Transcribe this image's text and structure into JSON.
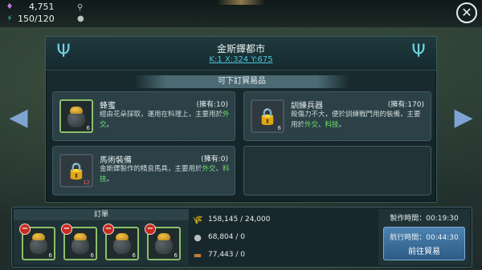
{
  "status_bar": {
    "gems": "4,751",
    "energy": "150/120"
  },
  "dialog": {
    "city_name": "金斯鐸都市",
    "coords": "K:1 X:324 Y:675",
    "section_title": "可下訂貿易品",
    "items": [
      {
        "title": "蜂蜜",
        "owned": "(擁有:10)",
        "desc_pre": "經由花朵採取，運用在料理上，主要用於",
        "desc_hl": [
          "外交"
        ],
        "desc_sep": "",
        "desc_post": "。",
        "count": "6",
        "locked": false
      },
      {
        "title": "訓練兵器",
        "owned": "(擁有:170)",
        "desc_pre": "殺傷力不大，便於訓練戰鬥用的裝備，主要用於",
        "desc_hl": [
          "外交",
          "科技"
        ],
        "desc_sep": "、",
        "desc_post": "。",
        "count": "6",
        "locked": true
      },
      {
        "title": "馬術裝備",
        "owned": "(擁有:0)",
        "desc_pre": "金斯鐸製作的精良馬具，主要用於",
        "desc_hl": [
          "外交",
          "科技"
        ],
        "desc_sep": "、",
        "desc_post": "。",
        "count": "12",
        "locked": true
      }
    ]
  },
  "orders": {
    "title": "訂單",
    "slots": [
      {
        "qty": "6"
      },
      {
        "qty": "6"
      },
      {
        "qty": "6"
      },
      {
        "qty": "6"
      }
    ]
  },
  "resources": [
    {
      "icon": "wheat-icon",
      "value": "158,145 / 24,000"
    },
    {
      "icon": "stone-icon",
      "value": "68,804 / 0"
    },
    {
      "icon": "wood-icon",
      "value": "77,443 / 0"
    }
  ],
  "timers": {
    "production": "製作時間：00:19:30",
    "sailing": "航行時間：00:44:30",
    "go_label": "前往貿易"
  }
}
